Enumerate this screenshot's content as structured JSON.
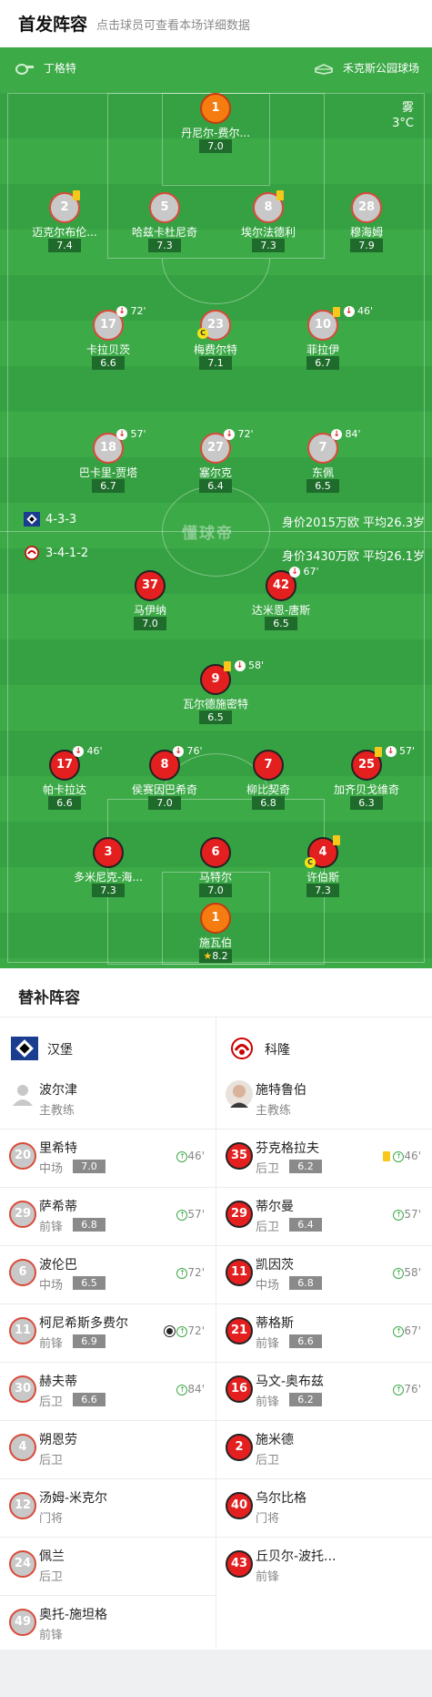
{
  "header": {
    "title": "首发阵容",
    "hint": "点击球员可查看本场详细数据"
  },
  "pitch": {
    "referee": "丁格特",
    "stadium": "禾克斯公园球场",
    "weather": "雾",
    "temperature": "3°C",
    "watermark": "懂球帝",
    "home": {
      "formation": "4-3-3",
      "value": "身价2015万欧 平均26.3岁"
    },
    "away": {
      "formation": "3-4-1-2",
      "value": "身价3430万欧 平均26.1岁"
    }
  },
  "home_players": [
    {
      "num": "1",
      "name": "丹尼尔-费尔...",
      "rating": "7.0"
    },
    {
      "num": "2",
      "name": "迈克尔布伦...",
      "rating": "7.4"
    },
    {
      "num": "5",
      "name": "哈兹卡杜尼奇",
      "rating": "7.3"
    },
    {
      "num": "8",
      "name": "埃尔法德利",
      "rating": "7.3"
    },
    {
      "num": "28",
      "name": "穆海姆",
      "rating": "7.9"
    },
    {
      "num": "17",
      "name": "卡拉贝茨",
      "rating": "6.6",
      "sub": "72'"
    },
    {
      "num": "23",
      "name": "梅费尔特",
      "rating": "7.1"
    },
    {
      "num": "10",
      "name": "菲拉伊",
      "rating": "6.7",
      "sub": "46'"
    },
    {
      "num": "18",
      "name": "巴卡里-贾塔",
      "rating": "6.7",
      "sub": "57'"
    },
    {
      "num": "27",
      "name": "塞尔克",
      "rating": "6.4",
      "sub": "72'"
    },
    {
      "num": "7",
      "name": "东佩",
      "rating": "6.5",
      "sub": "84'"
    }
  ],
  "away_players": [
    {
      "num": "37",
      "name": "马伊纳",
      "rating": "7.0"
    },
    {
      "num": "42",
      "name": "达米恩-唐斯",
      "rating": "6.5",
      "sub": "67'"
    },
    {
      "num": "9",
      "name": "瓦尔德施密特",
      "rating": "6.5",
      "sub": "58'"
    },
    {
      "num": "17",
      "name": "帕卡拉达",
      "rating": "6.6",
      "sub": "46'"
    },
    {
      "num": "8",
      "name": "侯赛因巴希奇",
      "rating": "7.0",
      "sub": "76'"
    },
    {
      "num": "7",
      "name": "柳比契奇",
      "rating": "6.8"
    },
    {
      "num": "25",
      "name": "加齐贝戈维奇",
      "rating": "6.3",
      "sub": "57'"
    },
    {
      "num": "3",
      "name": "多米尼克-海...",
      "rating": "7.3"
    },
    {
      "num": "6",
      "name": "马特尔",
      "rating": "7.0"
    },
    {
      "num": "4",
      "name": "许伯斯",
      "rating": "7.3"
    },
    {
      "num": "1",
      "name": "施瓦伯",
      "rating": "8.2"
    }
  ],
  "icons": {
    "captain": "C",
    "sub_off": "↓",
    "sub_on": "↑",
    "star": "★"
  },
  "subs": {
    "title": "替补阵容",
    "home": {
      "team": "汉堡",
      "coach": {
        "name": "波尔津",
        "role": "主教练"
      },
      "players": [
        {
          "num": "20",
          "name": "里希特",
          "pos": "中场",
          "rating": "7.0",
          "min": "46'"
        },
        {
          "num": "29",
          "name": "萨希蒂",
          "pos": "前锋",
          "rating": "6.8",
          "min": "57'"
        },
        {
          "num": "6",
          "name": "波伦巴",
          "pos": "中场",
          "rating": "6.5",
          "min": "72'"
        },
        {
          "num": "11",
          "name": "柯尼希斯多费尔",
          "pos": "前锋",
          "rating": "6.9",
          "min": "72'"
        },
        {
          "num": "30",
          "name": "赫夫蒂",
          "pos": "后卫",
          "rating": "6.6",
          "min": "84'"
        },
        {
          "num": "4",
          "name": "朔恩劳",
          "pos": "后卫"
        },
        {
          "num": "12",
          "name": "汤姆-米克尔",
          "pos": "门将"
        },
        {
          "num": "24",
          "name": "佩兰",
          "pos": "后卫"
        },
        {
          "num": "49",
          "name": "奥托-施坦格",
          "pos": "前锋"
        }
      ]
    },
    "away": {
      "team": "科隆",
      "coach": {
        "name": "施特鲁伯",
        "role": "主教练"
      },
      "players": [
        {
          "num": "35",
          "name": "芬克格拉夫",
          "pos": "后卫",
          "rating": "6.2",
          "min": "46'"
        },
        {
          "num": "29",
          "name": "蒂尔曼",
          "pos": "后卫",
          "rating": "6.4",
          "min": "57'"
        },
        {
          "num": "11",
          "name": "凯因茨",
          "pos": "中场",
          "rating": "6.8",
          "min": "58'"
        },
        {
          "num": "21",
          "name": "蒂格斯",
          "pos": "前锋",
          "rating": "6.6",
          "min": "67'"
        },
        {
          "num": "16",
          "name": "马文-奥布兹",
          "pos": "前锋",
          "rating": "6.2",
          "min": "76'"
        },
        {
          "num": "2",
          "name": "施米德",
          "pos": "后卫"
        },
        {
          "num": "40",
          "name": "乌尔比格",
          "pos": "门将"
        },
        {
          "num": "43",
          "name": "丘贝尔-波托...",
          "pos": "前锋"
        }
      ]
    }
  },
  "colors": {
    "pitch": "#3daa48",
    "home_ring": "#d94a3a",
    "away_fill": "#e31f1f",
    "gk_fill": "#f57c10",
    "rating_bg": "#1e6b2b"
  }
}
